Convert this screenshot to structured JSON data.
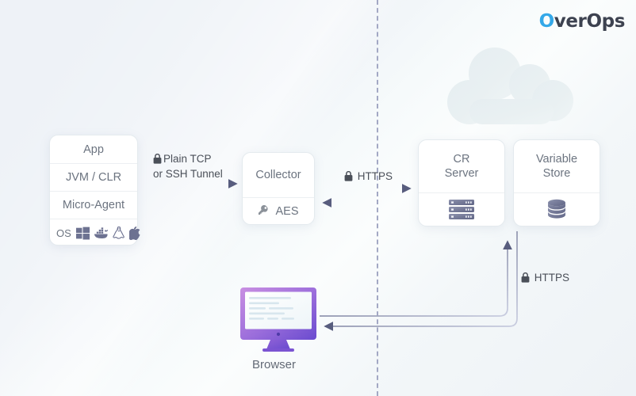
{
  "brand": {
    "name_part1": "O",
    "name_part2": "verOps",
    "accent": "#34a8e8",
    "text_color": "#3d4250"
  },
  "canvas": {
    "background": "#eff3f7",
    "divider_color": "#a3a8c4",
    "cloud_color": "#e7eef1"
  },
  "app_stack": {
    "name": "App",
    "rows": [
      {
        "label": "App"
      },
      {
        "label": "JVM / CLR"
      },
      {
        "label": "Micro-Agent"
      }
    ],
    "os_label": "OS",
    "os_icons": [
      "windows-icon",
      "docker-icon",
      "linux-icon",
      "apple-icon"
    ],
    "icon_color": "#6d7291"
  },
  "collector": {
    "title": "Collector",
    "encryption_label": "AES",
    "encryption_icon": "key-icon"
  },
  "servers": [
    {
      "name": "cr-server",
      "line1": "CR",
      "line2": "Server",
      "icon": "server-rack-icon"
    },
    {
      "name": "variable-store",
      "line1": "Variable",
      "line2": "Store",
      "icon": "database-icon"
    }
  ],
  "connections": [
    {
      "name": "app-to-collector",
      "icon": "lock-icon",
      "line1": "Plain TCP",
      "line2": "or SSH Tunnel",
      "direction": "right"
    },
    {
      "name": "collector-to-cr-server",
      "icon": "lock-icon",
      "line1": "HTTPS",
      "line2": "",
      "direction": "bidirectional"
    },
    {
      "name": "browser-to-cr-server",
      "icon": "lock-icon",
      "line1": "HTTPS",
      "line2": "",
      "direction": "bidirectional"
    }
  ],
  "browser": {
    "caption": "Browser",
    "bezel_gradient_from": "#c88fe0",
    "bezel_gradient_to": "#6d4fd0",
    "screen_color": "#ffffff",
    "content_line_color": "#d6e4ec"
  },
  "colors": {
    "arrow_dark": "#5b6080",
    "arrow_light": "#c3c8dd",
    "card_text": "#6c7480",
    "label_text": "#4a4f58"
  }
}
